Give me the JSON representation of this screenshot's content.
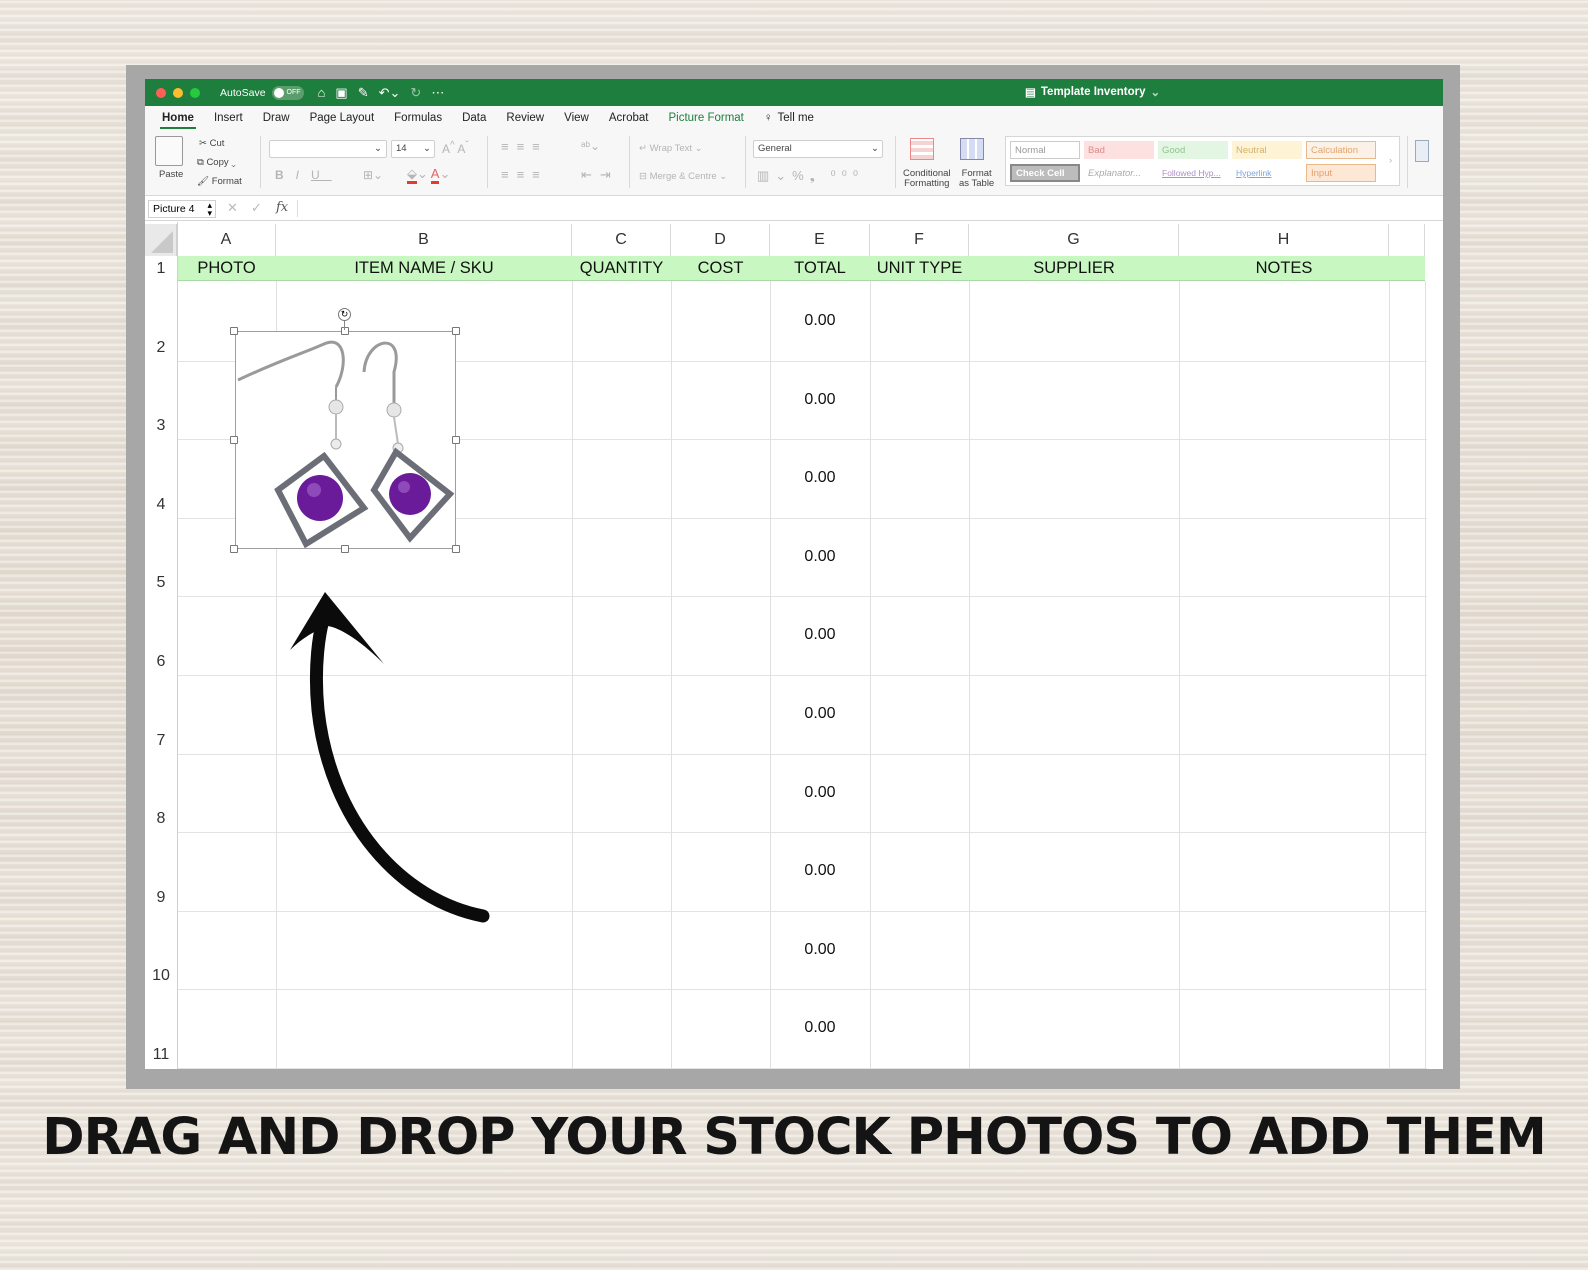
{
  "window": {
    "autosave_label": "AutoSave",
    "autosave_state": "OFF",
    "document_title": "Template Inventory"
  },
  "tabs": [
    "Home",
    "Insert",
    "Draw",
    "Page Layout",
    "Formulas",
    "Data",
    "Review",
    "View",
    "Acrobat",
    "Picture Format",
    "Tell me"
  ],
  "ribbon": {
    "paste": "Paste",
    "cut": "Cut",
    "copy": "Copy",
    "format": "Format",
    "font_size": "14",
    "wrap_text": "Wrap Text",
    "merge_centre": "Merge & Centre",
    "number_format": "General",
    "conditional_formatting_line1": "Conditional",
    "conditional_formatting_line2": "Formatting",
    "format_as_table_line1": "Format",
    "format_as_table_line2": "as Table",
    "styles": {
      "normal": "Normal",
      "bad": "Bad",
      "good": "Good",
      "neutral": "Neutral",
      "calculation": "Calculation",
      "check_cell": "Check Cell",
      "explanatory": "Explanator...",
      "followed_hyperlink": "Followed Hyp...",
      "hyperlink": "Hyperlink",
      "input": "Input"
    }
  },
  "formula_bar": {
    "name_box": "Picture 4",
    "fx": "fx"
  },
  "sheet": {
    "columns": [
      "A",
      "B",
      "C",
      "D",
      "E",
      "F",
      "G",
      "H"
    ],
    "headers": [
      "PHOTO",
      "ITEM NAME / SKU",
      "QUANTITY",
      "COST",
      "TOTAL",
      "UNIT TYPE",
      "SUPPLIER",
      "NOTES"
    ],
    "row_numbers": [
      "1",
      "2",
      "3",
      "4",
      "5",
      "6",
      "7",
      "8",
      "9",
      "10",
      "11"
    ],
    "total_values": [
      "0.00",
      "0.00",
      "0.00",
      "0.00",
      "0.00",
      "0.00",
      "0.00",
      "0.00",
      "0.00",
      "0.00"
    ]
  },
  "caption": "DRAG AND DROP YOUR STOCK PHOTOS TO ADD THEM",
  "colors": {
    "excel_green": "#1e7e3e",
    "header_fill": "#c8f7c2",
    "bead_purple": "#6a1b9a"
  }
}
